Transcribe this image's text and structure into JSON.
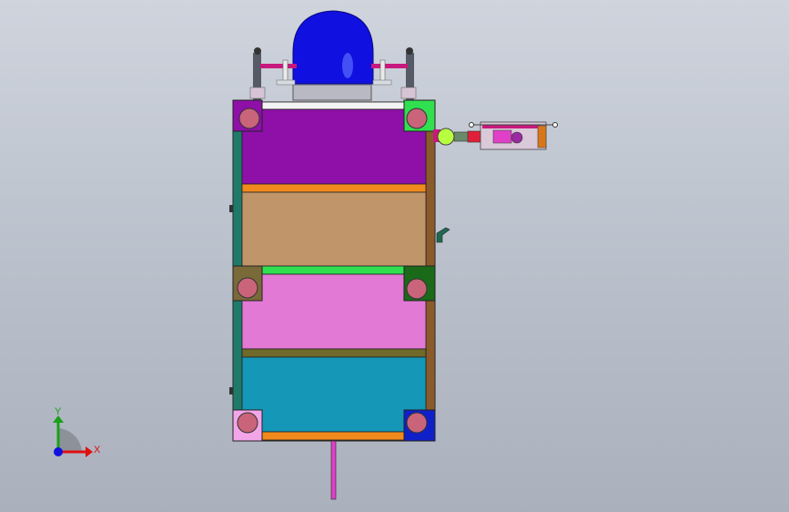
{
  "viewport": {
    "background_top": "#cfd4dd",
    "background_bottom": "#aab1bd"
  },
  "model": {
    "palette": {
      "frame_left": "#1f7a6a",
      "frame_right": "#8b5a2b",
      "panel_purple": "#8e10a8",
      "panel_tan": "#c0956a",
      "panel_pink": "#e279d4",
      "panel_teal": "#1597b8",
      "dome": "#1010e0",
      "accent_orange": "#f08a1c",
      "accent_green": "#30e050",
      "accent_olive": "#6f6a2a",
      "rod": "#e040c8"
    },
    "corner_blocks": [
      "purple",
      "green",
      "olive",
      "dark-green",
      "light-pink",
      "blue"
    ]
  },
  "triad": {
    "y_label": "Y",
    "x_label": "X",
    "y_color": "#1aa01a",
    "x_color": "#e01010",
    "z_color": "#1010e0"
  }
}
